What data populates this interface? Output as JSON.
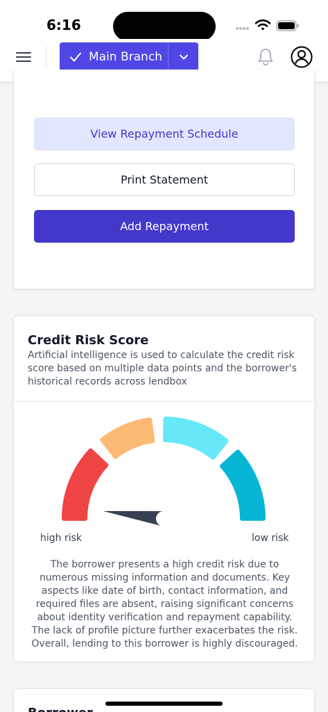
{
  "status_bar": {
    "time": "6:16"
  },
  "header": {
    "branch_label": "Main Branch",
    "icons": [
      "menu-icon",
      "check-icon",
      "chevron-down-icon",
      "bell-icon",
      "user-icon"
    ]
  },
  "actions": {
    "view_schedule": "View Repayment Schedule",
    "print_statement": "Print Statement",
    "add_repayment": "Add Repayment"
  },
  "credit_risk": {
    "title": "Credit Risk Score",
    "description": "Artificial intelligence is used to calculate the credit risk score based on multiple data points and the borrower's historical records across lendbox",
    "high_label": "high risk",
    "low_label": "low risk",
    "summary": "The borrower presents a high credit risk due to numerous missing information and documents. Key aspects like date of birth, contact information, and required files are absent, raising significant concerns about identity verification and repayment capability. The lack of profile picture further exacerbates the risk. Overall, lending to this borrower is highly discouraged.",
    "gauge_level": 0.04,
    "gauge_colors": [
      "#ef4444",
      "#fdba74",
      "#67e8f9",
      "#06b6d4"
    ],
    "needle_color": "#374151"
  },
  "borrower": {
    "title": "Borrower"
  },
  "colors": {
    "primary": "#4f46e5",
    "primary_dark": "#4338ca",
    "primary_light": "#e0e7ff"
  }
}
